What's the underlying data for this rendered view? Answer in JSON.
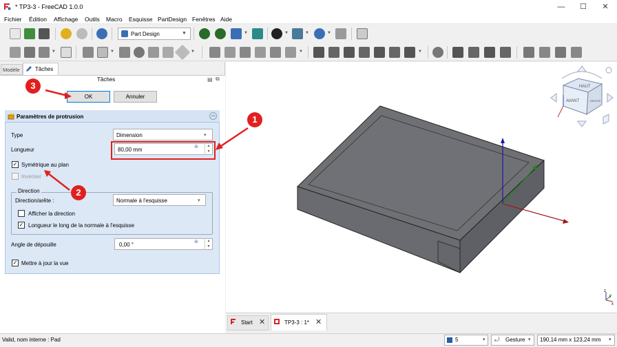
{
  "window": {
    "title": "* TP3-3 - FreeCAD 1.0.0",
    "controls": {
      "minimize": "—",
      "maximize": "☐",
      "close": "✕"
    }
  },
  "menu": [
    "Fichier",
    "Édition",
    "Affichage",
    "Outils",
    "Macro",
    "Esquisse",
    "PartDesign",
    "Fenêtres",
    "Aide"
  ],
  "toolbar": {
    "workbench": "Part Design"
  },
  "left_panel": {
    "tabs": [
      "Modèle",
      "Tâches"
    ],
    "tasks_title": "Tâches",
    "ok_label": "OK",
    "cancel_label": "Annuler",
    "params": {
      "title": "Paramètres de protrusion",
      "type_label": "Type",
      "type_value": "Dimension",
      "length_label": "Longueur",
      "length_value": "80,00 mm",
      "symmetric_label": "Symétrique au plan",
      "symmetric_checked": true,
      "reverse_label": "Inverser",
      "reverse_checked": false,
      "direction_group_title": "Direction",
      "direction_edge_label": "Direction/arête :",
      "direction_edge_value": "Normale à l'esquisse",
      "show_direction_label": "Afficher la direction",
      "show_direction_checked": false,
      "length_along_normal_label": "Longueur le long de la normale à l'esquisse",
      "length_along_normal_checked": true,
      "taper_label": "Angle de dépouille",
      "taper_value": "0,00 °",
      "update_view_label": "Mettre à jour la vue",
      "update_view_checked": true
    }
  },
  "annotations": [
    "1",
    "2",
    "3"
  ],
  "viewport": {
    "navcube": {
      "top_face": "HAUT",
      "front_face": "AVANT",
      "right_face": "DROITE"
    },
    "axis_labels": {
      "x": "x",
      "y": "y",
      "z": "z"
    }
  },
  "doc_tabs": [
    "Start",
    "TP3-3 : 1*"
  ],
  "statusbar": {
    "message": "Valid, nom interne : Pad",
    "value_5": "5",
    "navigation": "Gesture",
    "dimensions": "190,14 mm x 123,24 mm"
  },
  "colors": {
    "accent_red": "#e02020",
    "params_bg": "#dce8f6",
    "solid_face": "#6f7074"
  }
}
